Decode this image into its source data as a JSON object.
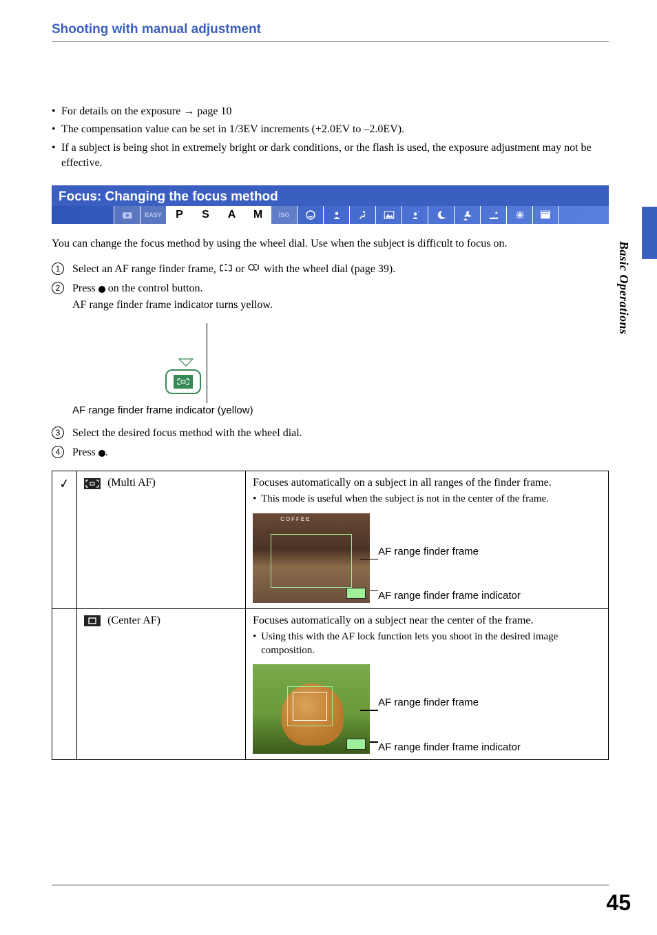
{
  "section_header": "Shooting with manual adjustment",
  "bullets": [
    "For details on the exposure → page 10",
    "The compensation value can be set in 1/3EV increments (+2.0EV to –2.0EV).",
    "If a subject is being shot in extremely bright or dark conditions, or the flash is used, the exposure adjustment may not be effective."
  ],
  "focus": {
    "header": "Focus: Changing the focus method",
    "modes": [
      "camera",
      "EASY",
      "P",
      "S",
      "A",
      "M",
      "iso",
      "smile",
      "portrait",
      "sport",
      "landscape",
      "soft",
      "twilight",
      "twilight-portrait",
      "beach",
      "fireworks",
      "movie"
    ],
    "intro": "You can change the focus method by using the wheel dial. Use when the subject is difficult to focus on.",
    "steps": {
      "s1_pre": "Select an AF range finder frame, ",
      "s1_mid": " or ",
      "s1_post": " with the wheel dial (page 39).",
      "s2_pre": "Press ",
      "s2_post": " on the control button.",
      "s2_sub": "AF range finder frame indicator turns yellow.",
      "s3": "Select the desired focus method with the wheel dial.",
      "s4_pre": "Press ",
      "s4_post": "."
    },
    "diagram_caption": "AF range finder frame indicator (yellow)"
  },
  "table": {
    "row1": {
      "label": " (Multi AF)",
      "desc": "Focuses automatically on a subject in all ranges of the finder frame.",
      "note": "This mode is useful when the subject is not in the center of the frame.",
      "callout1": "AF range finder frame",
      "callout2": "AF range finder frame indicator"
    },
    "row2": {
      "label": " (Center AF)",
      "desc": "Focuses automatically on a subject near the center of the frame.",
      "note": "Using this with the AF lock function lets you shoot in the desired image composition.",
      "callout1": "AF range finder frame",
      "callout2": "AF range finder frame indicator"
    }
  },
  "side_label": "Basic Operations",
  "page_number": "45",
  "thumb_sign": "COFFEE"
}
